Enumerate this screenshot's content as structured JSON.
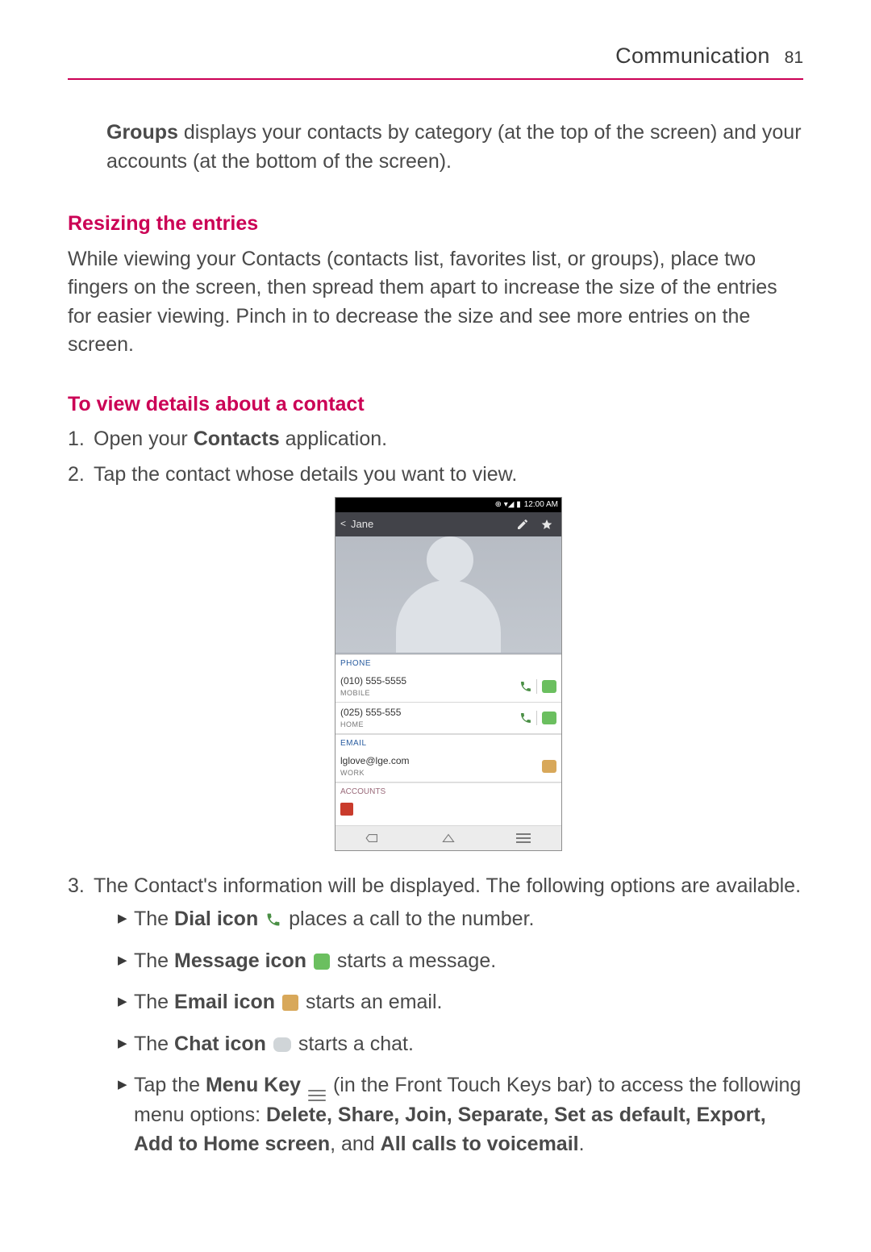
{
  "header": {
    "section": "Communication",
    "page": "81"
  },
  "groups_p1": "Groups",
  "groups_p2": " displays your contacts by category (at the top of the screen) and your accounts (at the bottom of the screen).",
  "h_resize": "Resizing the entries",
  "p_resize": "While viewing your Contacts (contacts list, favorites list, or groups), place two fingers on the screen, then spread them apart to increase the size of the entries for easier viewing. Pinch in to decrease the size and see more entries on the screen.",
  "h_view": "To view details about a contact",
  "step1_a": "Open your ",
  "step1_b": "Contacts",
  "step1_c": " application.",
  "step2": "Tap the contact whose details you want to view.",
  "step3": "The Contact's information will be displayed. The following options are available.",
  "sub_dial_a": "The ",
  "sub_dial_b": "Dial icon",
  "sub_dial_c": " places a call to the number.",
  "sub_msg_a": "The ",
  "sub_msg_b": "Message icon",
  "sub_msg_c": " starts a message.",
  "sub_email_a": "The ",
  "sub_email_b": "Email icon",
  "sub_email_c": " starts an email.",
  "sub_chat_a": "The ",
  "sub_chat_b": "Chat icon",
  "sub_chat_c": " starts a chat.",
  "sub_menu_a": "Tap the ",
  "sub_menu_b": "Menu Key",
  "sub_menu_c": " (in the Front Touch Keys bar) to access the following menu options: ",
  "sub_menu_opts": "Delete, Share, Join, Separate, Set as default, Export, Add to Home screen",
  "sub_menu_d": ", and ",
  "sub_menu_e": "All calls to voicemail",
  "sub_menu_f": ".",
  "phone": {
    "time": "12:00 AM",
    "name": "Jane",
    "sec_phone": "PHONE",
    "row1_num": "(010) 555-5555",
    "row1_type": "MOBILE",
    "row2_num": "(025) 555-555",
    "row2_type": "HOME",
    "sec_email": "EMAIL",
    "email_val": "lglove@lge.com",
    "email_type": "WORK",
    "sec_accounts": "ACCOUNTS"
  }
}
